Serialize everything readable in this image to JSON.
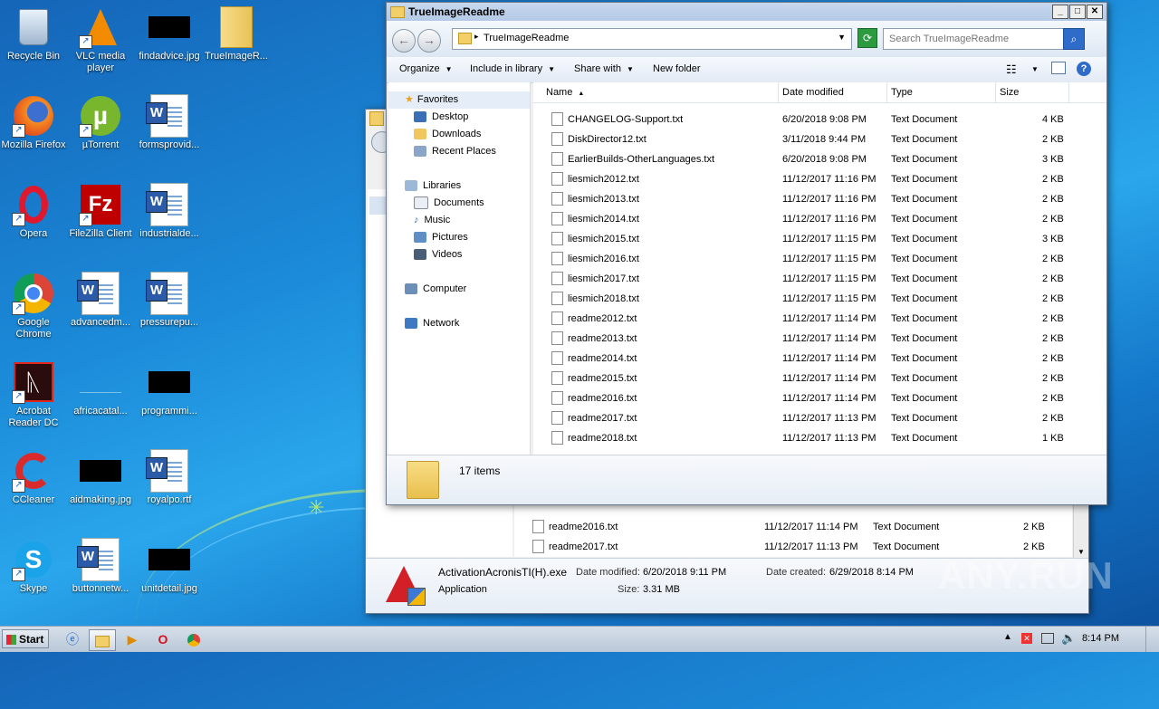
{
  "desktop": {
    "icons": [
      {
        "label": "Recycle Bin"
      },
      {
        "label": "VLC media player"
      },
      {
        "label": "findadvice.jpg"
      },
      {
        "label": "TrueImageR..."
      },
      {
        "label": "Mozilla Firefox"
      },
      {
        "label": "µTorrent"
      },
      {
        "label": "formsprovid..."
      },
      {
        "label": "Opera"
      },
      {
        "label": "FileZilla Client"
      },
      {
        "label": "industrialde..."
      },
      {
        "label": "Google Chrome"
      },
      {
        "label": "advancedm..."
      },
      {
        "label": "pressurepu..."
      },
      {
        "label": "Acrobat Reader DC"
      },
      {
        "label": "africacatal..."
      },
      {
        "label": "programmi..."
      },
      {
        "label": "CCleaner"
      },
      {
        "label": "aidmaking.jpg"
      },
      {
        "label": "royalpo.rtf"
      },
      {
        "label": "Skype"
      },
      {
        "label": "buttonnetw..."
      },
      {
        "label": "unitdetail.jpg"
      }
    ]
  },
  "explorer": {
    "title": "TrueImageReadme",
    "address": "TrueImageReadme",
    "search_placeholder": "Search TrueImageReadme",
    "toolbar": {
      "organize": "Organize",
      "include": "Include in library",
      "share": "Share with",
      "newfolder": "New folder"
    },
    "nav": {
      "favorites": "Favorites",
      "desktop": "Desktop",
      "downloads": "Downloads",
      "recent": "Recent Places",
      "libraries": "Libraries",
      "documents": "Documents",
      "music": "Music",
      "pictures": "Pictures",
      "videos": "Videos",
      "computer": "Computer",
      "network": "Network"
    },
    "columns": {
      "name": "Name",
      "date": "Date modified",
      "type": "Type",
      "size": "Size"
    },
    "files": [
      {
        "name": "CHANGELOG-Support.txt",
        "date": "6/20/2018 9:08 PM",
        "type": "Text Document",
        "size": "4 KB"
      },
      {
        "name": "DiskDirector12.txt",
        "date": "3/11/2018 9:44 PM",
        "type": "Text Document",
        "size": "2 KB"
      },
      {
        "name": "EarlierBuilds-OtherLanguages.txt",
        "date": "6/20/2018 9:08 PM",
        "type": "Text Document",
        "size": "3 KB"
      },
      {
        "name": "liesmich2012.txt",
        "date": "11/12/2017 11:16 PM",
        "type": "Text Document",
        "size": "2 KB"
      },
      {
        "name": "liesmich2013.txt",
        "date": "11/12/2017 11:16 PM",
        "type": "Text Document",
        "size": "2 KB"
      },
      {
        "name": "liesmich2014.txt",
        "date": "11/12/2017 11:16 PM",
        "type": "Text Document",
        "size": "2 KB"
      },
      {
        "name": "liesmich2015.txt",
        "date": "11/12/2017 11:15 PM",
        "type": "Text Document",
        "size": "3 KB"
      },
      {
        "name": "liesmich2016.txt",
        "date": "11/12/2017 11:15 PM",
        "type": "Text Document",
        "size": "2 KB"
      },
      {
        "name": "liesmich2017.txt",
        "date": "11/12/2017 11:15 PM",
        "type": "Text Document",
        "size": "2 KB"
      },
      {
        "name": "liesmich2018.txt",
        "date": "11/12/2017 11:15 PM",
        "type": "Text Document",
        "size": "2 KB"
      },
      {
        "name": "readme2012.txt",
        "date": "11/12/2017 11:14 PM",
        "type": "Text Document",
        "size": "2 KB"
      },
      {
        "name": "readme2013.txt",
        "date": "11/12/2017 11:14 PM",
        "type": "Text Document",
        "size": "2 KB"
      },
      {
        "name": "readme2014.txt",
        "date": "11/12/2017 11:14 PM",
        "type": "Text Document",
        "size": "2 KB"
      },
      {
        "name": "readme2015.txt",
        "date": "11/12/2017 11:14 PM",
        "type": "Text Document",
        "size": "2 KB"
      },
      {
        "name": "readme2016.txt",
        "date": "11/12/2017 11:14 PM",
        "type": "Text Document",
        "size": "2 KB"
      },
      {
        "name": "readme2017.txt",
        "date": "11/12/2017 11:13 PM",
        "type": "Text Document",
        "size": "2 KB"
      },
      {
        "name": "readme2018.txt",
        "date": "11/12/2017 11:13 PM",
        "type": "Text Document",
        "size": "1 KB"
      }
    ],
    "item_count": "17 items"
  },
  "backwindow": {
    "rows": [
      {
        "name": "readme2016.txt",
        "date": "11/12/2017 11:14 PM",
        "type": "Text Document",
        "size": "2 KB"
      },
      {
        "name": "readme2017.txt",
        "date": "11/12/2017 11:13 PM",
        "type": "Text Document",
        "size": "2 KB"
      }
    ],
    "detail": {
      "filename": "ActivationAcronisTI(H).exe",
      "modified_label": "Date modified:",
      "modified": "6/20/2018 9:11 PM",
      "created_label": "Date created:",
      "created": "6/29/2018 8:14 PM",
      "type": "Application",
      "size_label": "Size:",
      "size": "3.31 MB"
    }
  },
  "taskbar": {
    "start": "Start",
    "clock": "8:14 PM"
  },
  "watermark": "ANY.RUN"
}
